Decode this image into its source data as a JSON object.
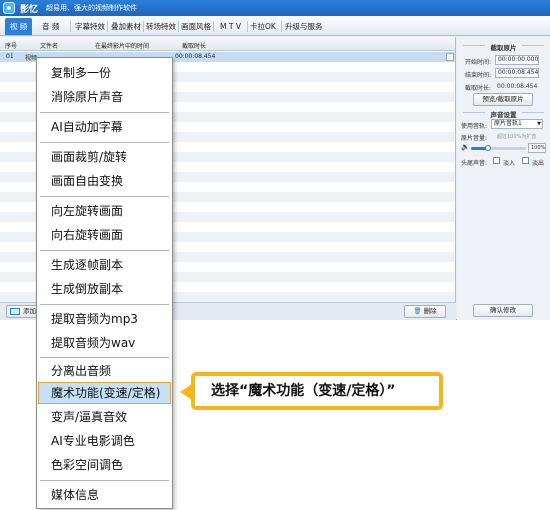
{
  "window": {
    "app_name": "影忆",
    "slogan": "超易用、强大的视频制作软件"
  },
  "tabs": [
    {
      "label": "视 频",
      "active": true
    },
    {
      "label": "音 频"
    },
    {
      "label": "字幕特效"
    },
    {
      "label": "叠加素材"
    },
    {
      "label": "转场特效"
    },
    {
      "label": "画面风格"
    },
    {
      "label": "M T V"
    },
    {
      "label": "卡拉OK"
    },
    {
      "label": "升级与服务"
    }
  ],
  "table": {
    "headers": [
      "序号",
      "文件名",
      "在最终影片中的时间",
      "截取时长"
    ],
    "first_row": {
      "index": "01",
      "name": "视频",
      "time": "00:00:08.454"
    }
  },
  "bottom_toolbar": {
    "add_label": "添加",
    "delete_label": "删除"
  },
  "side_panel": {
    "clip_title": "截取原片",
    "start_label": "开始时间:",
    "start_value": "00:00:00.000",
    "end_label": "结束时间:",
    "end_value": "00:00:08.454",
    "duration_label": "截取时长:",
    "duration_value": "00:00:08.454",
    "preview_button": "预览/截取原片",
    "sound_title": "声音设置",
    "track_label": "使用音轨:",
    "track_value": "原片音轨1",
    "volume_label": "原片音量:",
    "volume_hint": "超过100%为扩音",
    "volume_value": "100%",
    "volume_fraction": 0.3,
    "fade_label": "头尾声音:",
    "fade_in": "淡入",
    "fade_out": "淡出",
    "confirm_button": "确认修改"
  },
  "context_menu": {
    "items": [
      {
        "label": "复制多一份"
      },
      {
        "label": "消除原片声音"
      },
      {
        "label": "AI自动加字幕"
      },
      {
        "label": "画面裁剪/旋转"
      },
      {
        "label": "画面自由变换"
      },
      {
        "label": "向左旋转画面"
      },
      {
        "label": "向右旋转画面"
      },
      {
        "label": "生成逐帧副本"
      },
      {
        "label": "生成倒放副本"
      },
      {
        "label": "提取音频为mp3"
      },
      {
        "label": "提取音频为wav"
      },
      {
        "label": "分离出音频"
      },
      {
        "label": "魔术功能(变速/定格)",
        "highlighted": true
      },
      {
        "label": "变声/逼真音效"
      },
      {
        "label": "AI专业电影调色"
      },
      {
        "label": "色彩空间调色"
      },
      {
        "label": "媒体信息"
      }
    ]
  },
  "callout": {
    "text": "选择“魔术功能（变速/定格）”"
  },
  "colors": {
    "accent": "#2f7fd6",
    "highlight_border": "#e8a33d",
    "callout_border": "#f5b51c"
  }
}
